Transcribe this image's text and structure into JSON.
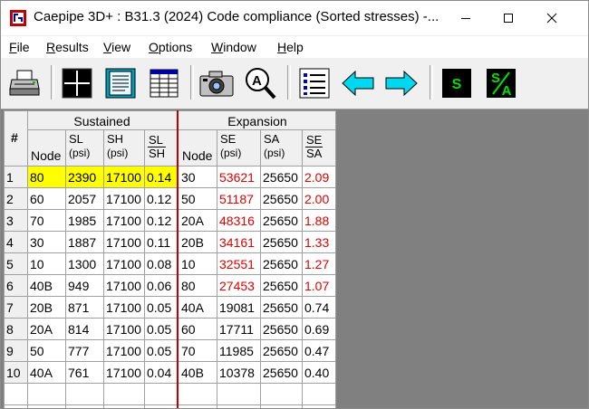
{
  "window": {
    "title": "Caepipe 3D+ : B31.3 (2024) Code compliance (Sorted stresses) -..."
  },
  "menu": [
    {
      "label": "File",
      "key": "F",
      "rest": "ile"
    },
    {
      "label": "Results",
      "key": "R",
      "rest": "esults"
    },
    {
      "label": "View",
      "key": "V",
      "rest": "iew"
    },
    {
      "label": "Options",
      "key": "O",
      "rest": "ptions"
    },
    {
      "label": "Window",
      "key": "W",
      "rest": "indow"
    },
    {
      "label": "Help",
      "key": "H",
      "rest": "elp"
    }
  ],
  "toolbar": {
    "s_label": "S",
    "sa_num": "S",
    "sa_den": "A"
  },
  "colors": {
    "highlight": "#ffff00",
    "red_text": "#e00000",
    "accent_cyan": "#00d8f0",
    "green": "#00e000"
  },
  "table": {
    "hash": "#",
    "group_sustained": "Sustained",
    "group_expansion": "Expansion",
    "headers": {
      "node1": "Node",
      "sl": "SL",
      "sl_unit": "(psi)",
      "sh": "SH",
      "sh_unit": "(psi)",
      "ratio1_num": "SL",
      "ratio1_den": "SH",
      "node2": "Node",
      "se": "SE",
      "se_unit": "(psi)",
      "sa": "SA",
      "sa_unit": "(psi)",
      "ratio2_num": "SE",
      "ratio2_den": "SA"
    },
    "rows": [
      {
        "n": "1",
        "node1": "80",
        "sl": "2390",
        "sh": "17100",
        "r1": "0.14",
        "node2": "30",
        "se": "53621",
        "sa": "25650",
        "r2": "2.09",
        "hl": true,
        "red": true
      },
      {
        "n": "2",
        "node1": "60",
        "sl": "2057",
        "sh": "17100",
        "r1": "0.12",
        "node2": "50",
        "se": "51187",
        "sa": "25650",
        "r2": "2.00",
        "hl": false,
        "red": true
      },
      {
        "n": "3",
        "node1": "70",
        "sl": "1985",
        "sh": "17100",
        "r1": "0.12",
        "node2": "20A",
        "se": "48316",
        "sa": "25650",
        "r2": "1.88",
        "hl": false,
        "red": true
      },
      {
        "n": "4",
        "node1": "30",
        "sl": "1887",
        "sh": "17100",
        "r1": "0.11",
        "node2": "20B",
        "se": "34161",
        "sa": "25650",
        "r2": "1.33",
        "hl": false,
        "red": true
      },
      {
        "n": "5",
        "node1": "10",
        "sl": "1300",
        "sh": "17100",
        "r1": "0.08",
        "node2": "10",
        "se": "32551",
        "sa": "25650",
        "r2": "1.27",
        "hl": false,
        "red": true
      },
      {
        "n": "6",
        "node1": "40B",
        "sl": "949",
        "sh": "17100",
        "r1": "0.06",
        "node2": "80",
        "se": "27453",
        "sa": "25650",
        "r2": "1.07",
        "hl": false,
        "red": true
      },
      {
        "n": "7",
        "node1": "20B",
        "sl": "871",
        "sh": "17100",
        "r1": "0.05",
        "node2": "40A",
        "se": "19081",
        "sa": "25650",
        "r2": "0.74",
        "hl": false,
        "red": false
      },
      {
        "n": "8",
        "node1": "20A",
        "sl": "814",
        "sh": "17100",
        "r1": "0.05",
        "node2": "60",
        "se": "17711",
        "sa": "25650",
        "r2": "0.69",
        "hl": false,
        "red": false
      },
      {
        "n": "9",
        "node1": "50",
        "sl": "777",
        "sh": "17100",
        "r1": "0.05",
        "node2": "70",
        "se": "11985",
        "sa": "25650",
        "r2": "0.47",
        "hl": false,
        "red": false
      },
      {
        "n": "10",
        "node1": "40A",
        "sl": "761",
        "sh": "17100",
        "r1": "0.04",
        "node2": "40B",
        "se": "10378",
        "sa": "25650",
        "r2": "0.40",
        "hl": false,
        "red": false
      }
    ]
  }
}
